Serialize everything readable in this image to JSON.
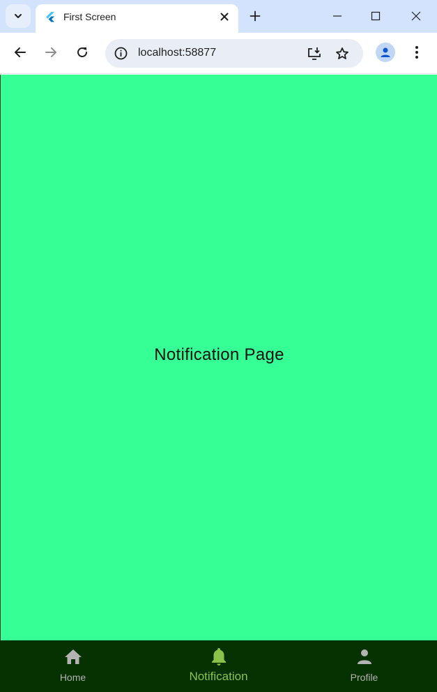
{
  "browser": {
    "tab_title": "First Screen",
    "url": "localhost:58877"
  },
  "page": {
    "text": "Notification Page",
    "background": "#36ff95"
  },
  "bottom_nav": {
    "background": "#063100",
    "active_color": "#8bc34a",
    "inactive_color": "#b3b3b3",
    "items": [
      {
        "label": "Home",
        "icon": "home-icon"
      },
      {
        "label": "Notification",
        "icon": "bell-icon",
        "active": true
      },
      {
        "label": "Profile",
        "icon": "person-icon"
      }
    ]
  }
}
